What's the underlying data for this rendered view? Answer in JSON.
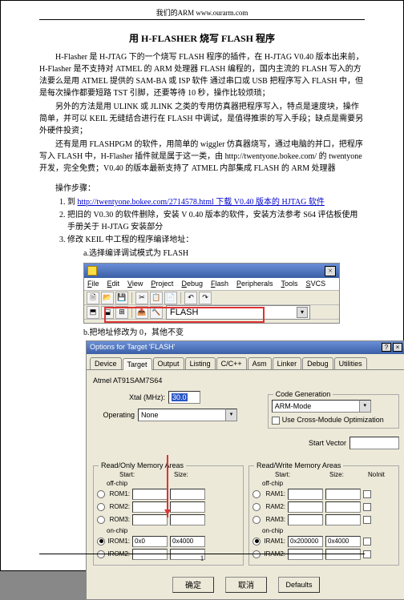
{
  "header": "我们的ARM    www.ourarm.com",
  "title": "用 H-FLASHER 烧写 FLASH 程序",
  "paragraphs": [
    "H-Flasher 是 H-JTAG 下的一个烧写 FLASH 程序的插件，在 H-JTAG  V0.40 版本出来前，H-Flasher 是不支持对 ATMEL 的 ARM 处理器 FLASH 编程的，国内主流的 FLASH 写入的方法要么是用 ATMEL 提供的 SAM-BA 或 ISP 软件 通过串口或 USB 把程序写入 FLASH 中，但是每次操作都要短路 TST 引脚，还要等待 10 秒，操作比较烦琐；",
    "另外的方法是用 ULINK 或 JLINK 之类的专用仿真器把程序写入，特点是速度块，操作简单，并可以 KEIL 无缝结合进行在 FLASH 中调试，是值得推崇的写入手段；缺点是需要另外硬件投资；",
    "还有是用 FLASHPGM 的软件，用简单的 wiggler 仿真器烧写，通过电脑的并口，把程序写入 FLASH 中，H-Flasher 插件就是属于这一类，由 http://twentyone.bokee.com/ 的 twentyone 开发，完全免费；V0.40 的版本最新支持了 ATMEL 内部集成 FLASH 的 ARM 处理器"
  ],
  "steps_label": "操作步骤：",
  "steps": [
    {
      "pre": "到 ",
      "link": "http://twentyone.bokee.com/2714578.html",
      "post": "  下载 V0.40 版本的 HJTAG 软件"
    },
    {
      "text": "把旧的 V0.30 的软件删除，安装 V 0.40 版本的软件，安装方法参考 S64 评估板使用手册关于 H-JTAG 安装部分"
    },
    {
      "text": "修改 KEIL 中工程的程序编译地址：",
      "sub_a": "a.选择编译调试模式为 FLASH"
    }
  ],
  "keil": {
    "menus": [
      "File",
      "Edit",
      "View",
      "Project",
      "Debug",
      "Flash",
      "Peripherals",
      "Tools",
      "SVCS"
    ],
    "dropdown_value": "FLASH"
  },
  "note_b": "b.把地址修改为 0，其他不变",
  "dialog": {
    "title": "Options for Target 'FLASH'",
    "tabs": [
      "Device",
      "Target",
      "Output",
      "Listing",
      "C/C++",
      "Asm",
      "Linker",
      "Debug",
      "Utilities"
    ],
    "active_tab": 1,
    "device_label": "Atmel AT91SAM7S64",
    "xtal_label": "Xtal (MHz):",
    "xtal_value": "30.0",
    "operating_label": "Operating",
    "operating_value": "None",
    "codegen_legend": "Code Generation",
    "armmode_label": "ARM-Mode",
    "crossmod_label": "Use Cross-Module Optimization",
    "startvector_label": "Start Vector",
    "ro_legend": "Read/Only Memory Areas",
    "rw_legend": "Read/Write Memory Areas",
    "hdr_start": "Start:",
    "hdr_size": "Size:",
    "hdr_noinit": "NoInit",
    "offchip": "off-chip",
    "onchip": "on-chip",
    "ro_rows": [
      {
        "label": "ROM1:",
        "start": "",
        "size": ""
      },
      {
        "label": "ROM2:",
        "start": "",
        "size": ""
      },
      {
        "label": "ROM3:",
        "start": "",
        "size": ""
      }
    ],
    "ro_on_rows": [
      {
        "label": "IROM1:",
        "start": "0x0",
        "size": "0x4000",
        "checked": true
      },
      {
        "label": "IROM2:",
        "start": "",
        "size": ""
      }
    ],
    "rw_rows": [
      {
        "label": "RAM1:",
        "start": "",
        "size": ""
      },
      {
        "label": "RAM2:",
        "start": "",
        "size": ""
      },
      {
        "label": "RAM3:",
        "start": "",
        "size": ""
      }
    ],
    "rw_on_rows": [
      {
        "label": "IRAM1:",
        "start": "0x200000",
        "size": "0x4000",
        "checked": true
      },
      {
        "label": "IRAM2:",
        "start": "",
        "size": ""
      }
    ],
    "buttons": {
      "ok": "确定",
      "cancel": "取消",
      "defaults": "Defaults"
    }
  },
  "pagenum": "1"
}
